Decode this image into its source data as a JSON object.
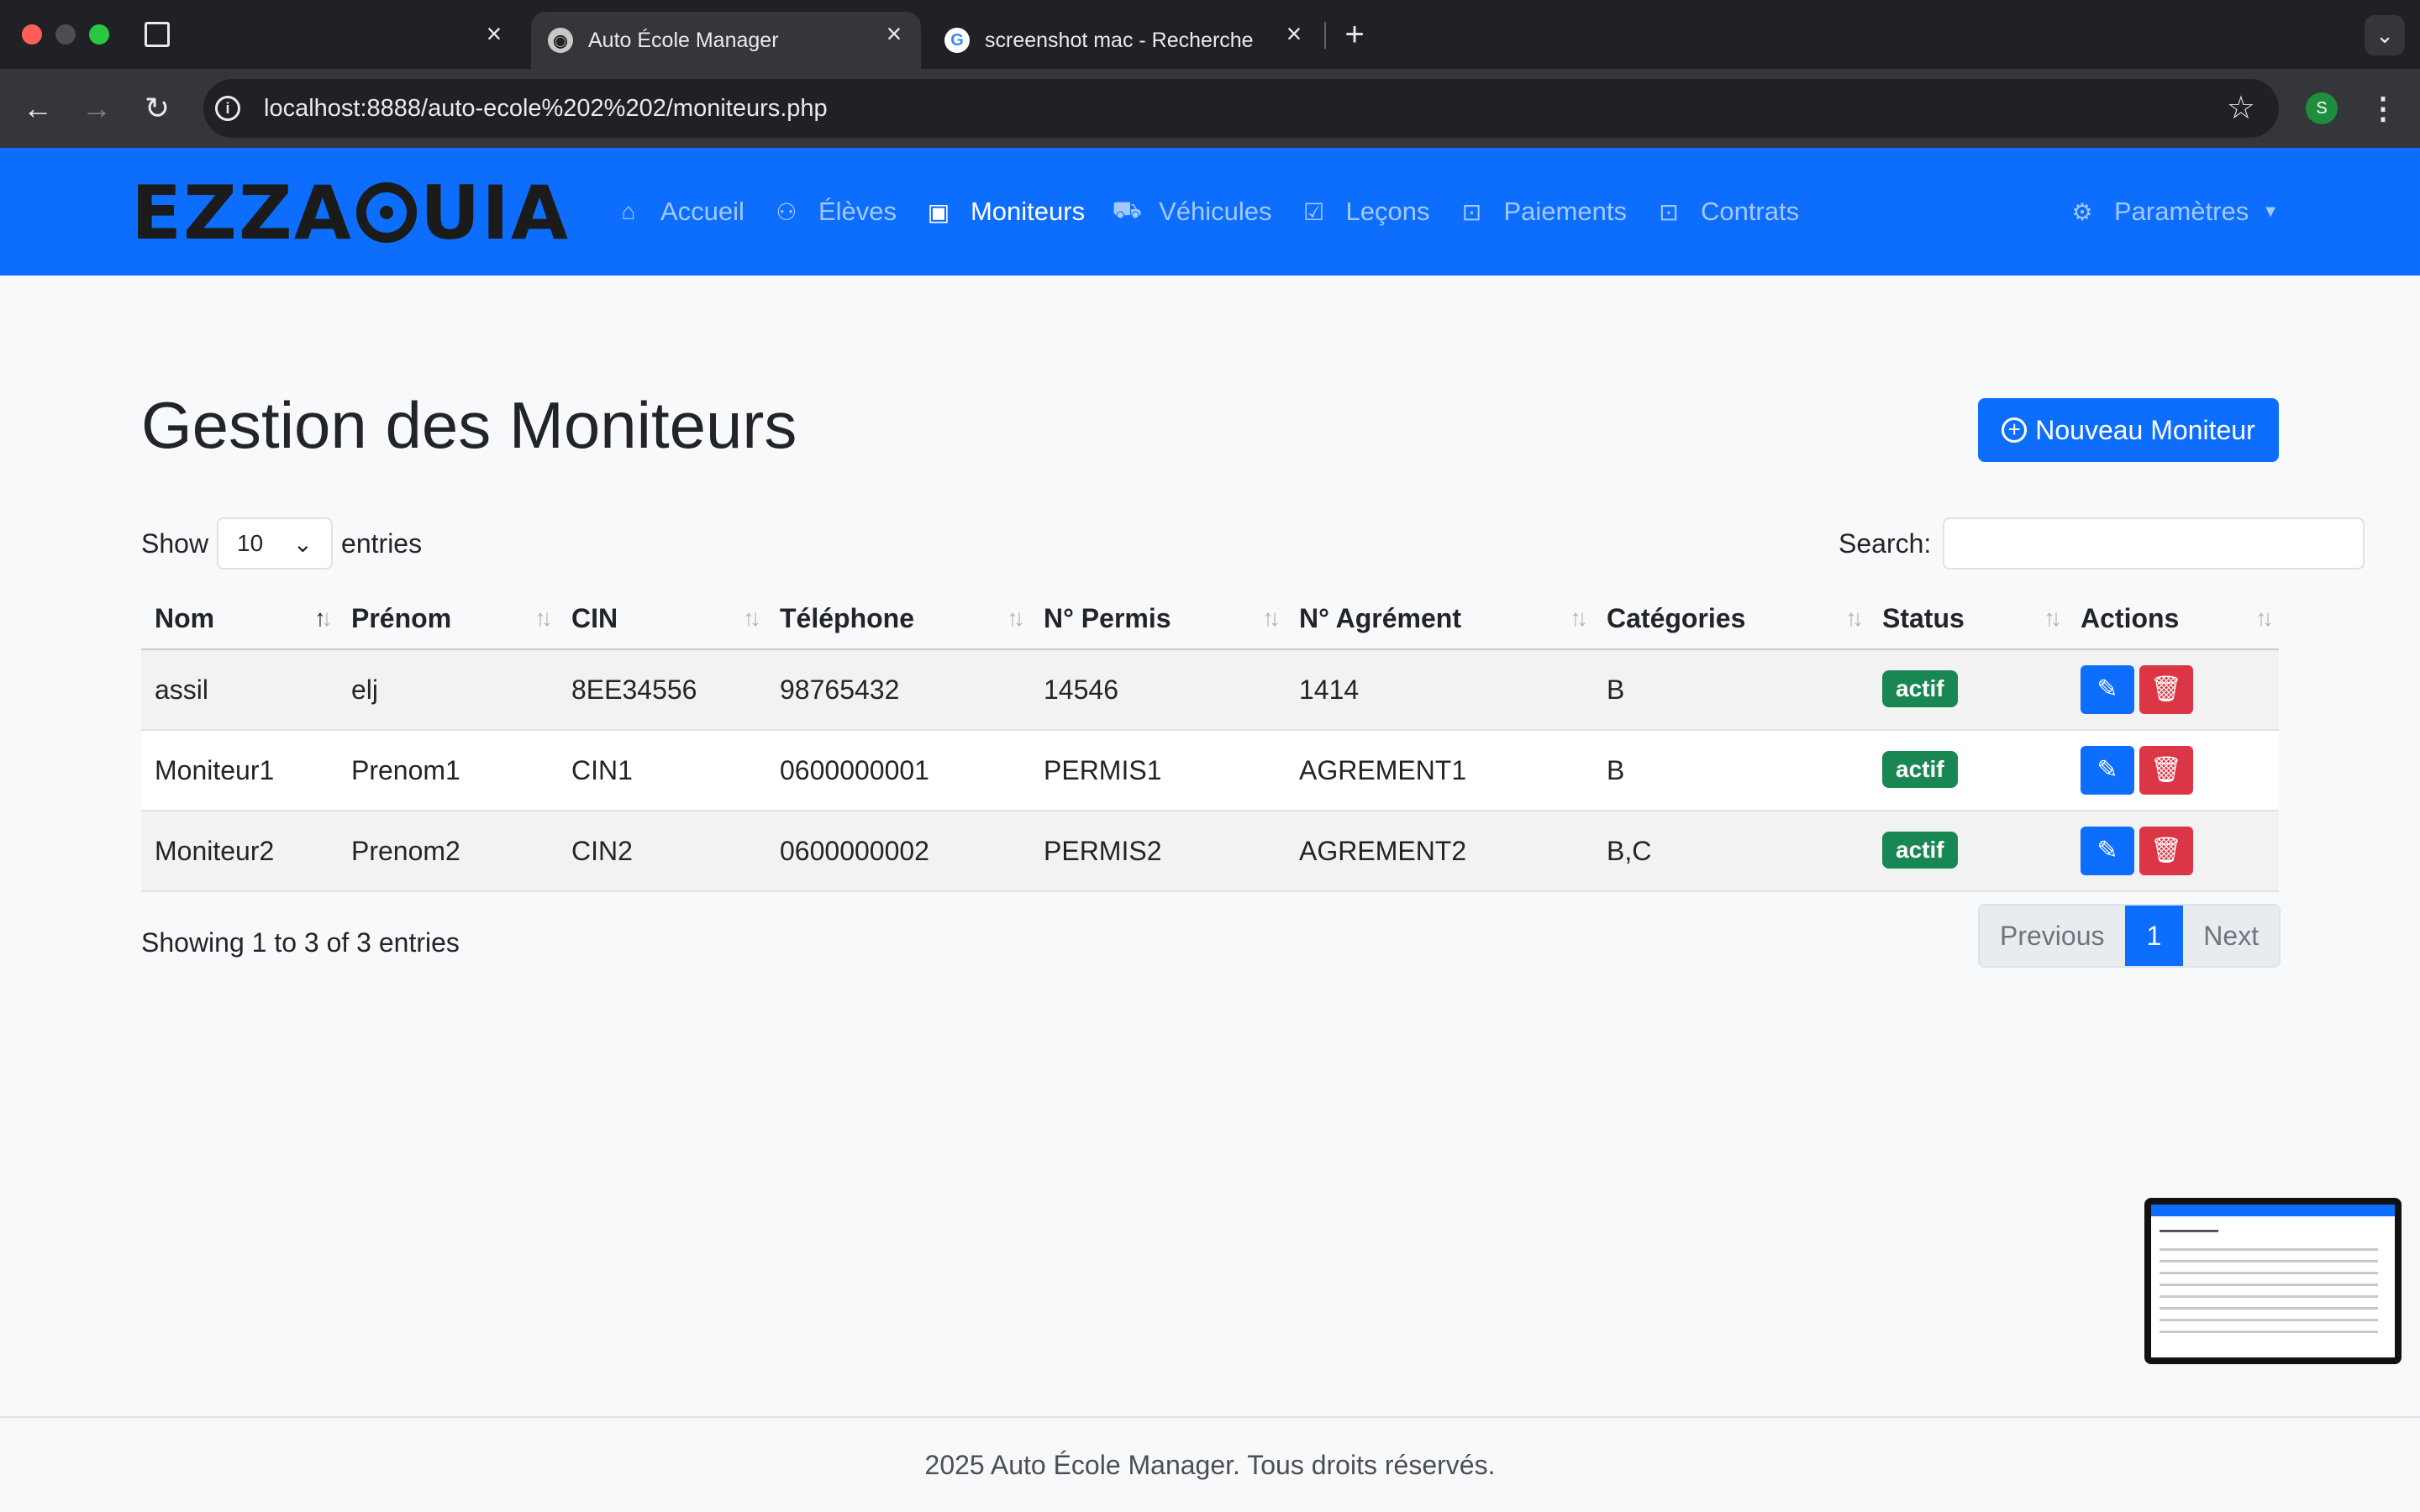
{
  "browser": {
    "tabs": [
      {
        "title": "Auto École Manager"
      },
      {
        "title": "screenshot mac - Recherche"
      }
    ],
    "url": "localhost:8888/auto-ecole%202%202/moniteurs.php",
    "profile_initial": "S"
  },
  "navbar": {
    "brand_left": "EZZA",
    "brand_right": "UIA",
    "items": [
      {
        "label": "Accueil",
        "icon": "house-icon"
      },
      {
        "label": "Élèves",
        "icon": "people-icon"
      },
      {
        "label": "Moniteurs",
        "icon": "badge-icon"
      },
      {
        "label": "Véhicules",
        "icon": "truck-icon"
      },
      {
        "label": "Leçons",
        "icon": "calendar-icon"
      },
      {
        "label": "Paiements",
        "icon": "cash-icon"
      },
      {
        "label": "Contrats",
        "icon": "contract-icon"
      }
    ],
    "active_item": "Moniteurs",
    "settings_label": "Paramètres"
  },
  "main": {
    "title": "Gestion des Moniteurs",
    "new_button_label": "Nouveau Moniteur",
    "length": {
      "show_label": "Show",
      "value": "10",
      "entries_label": "entries"
    },
    "search_label": "Search:",
    "search_value": "",
    "table": {
      "columns": [
        "Nom",
        "Prénom",
        "CIN",
        "Téléphone",
        "N° Permis",
        "N° Agrément",
        "Catégories",
        "Status",
        "Actions"
      ],
      "rows": [
        {
          "nom": "assil",
          "prenom": "elj",
          "cin": "8EE34556",
          "telephone": "98765432",
          "permis": "14546",
          "agrement": "1414",
          "categories": "B",
          "status": "actif"
        },
        {
          "nom": "Moniteur1",
          "prenom": "Prenom1",
          "cin": "CIN1",
          "telephone": "0600000001",
          "permis": "PERMIS1",
          "agrement": "AGREMENT1",
          "categories": "B",
          "status": "actif"
        },
        {
          "nom": "Moniteur2",
          "prenom": "Prenom2",
          "cin": "CIN2",
          "telephone": "0600000002",
          "permis": "PERMIS2",
          "agrement": "AGREMENT2",
          "categories": "B,C",
          "status": "actif"
        }
      ]
    },
    "info": "Showing 1 to 3 of 3 entries",
    "pagination": {
      "previous": "Previous",
      "current": "1",
      "next": "Next"
    }
  },
  "footer": {
    "text": "2025 Auto École Manager. Tous droits réservés."
  },
  "colors": {
    "primary": "#0d6efd",
    "success": "#198754",
    "danger": "#dc3545",
    "chrome_dark": "#202124"
  }
}
